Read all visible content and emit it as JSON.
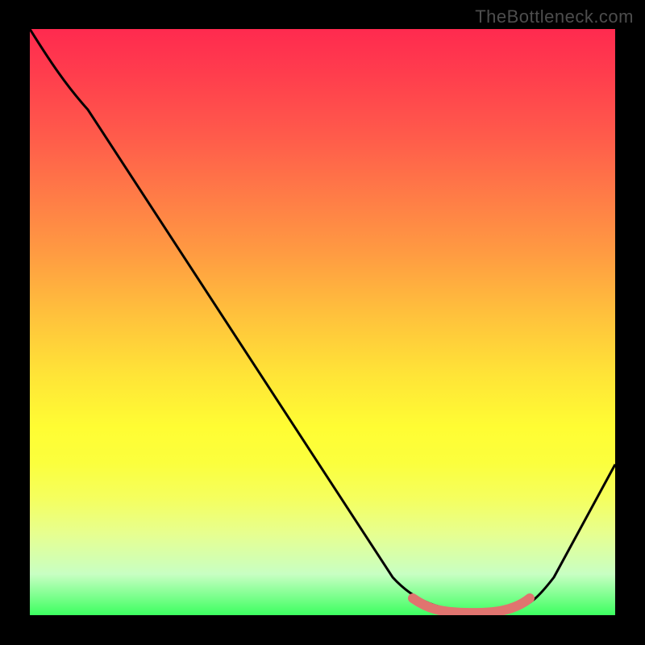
{
  "watermark": "TheBottleneck.com",
  "chart_data": {
    "type": "line",
    "title": "",
    "xlabel": "",
    "ylabel": "",
    "xlim": [
      0,
      100
    ],
    "ylim": [
      0,
      100
    ],
    "grid": false,
    "legend": false,
    "background_gradient": {
      "direction": "vertical",
      "stops": [
        {
          "pos": 0.0,
          "color": "#ff2a4f"
        },
        {
          "pos": 0.4,
          "color": "#ff9a42"
        },
        {
          "pos": 0.68,
          "color": "#fffd33"
        },
        {
          "pos": 1.0,
          "color": "#3cff60"
        }
      ]
    },
    "series": [
      {
        "name": "bottleneck-curve",
        "color": "#000000",
        "x": [
          0,
          5,
          10,
          20,
          30,
          40,
          50,
          60,
          65,
          70,
          75,
          80,
          85,
          90,
          95,
          100
        ],
        "y": [
          100,
          92,
          86,
          73,
          60,
          47,
          34,
          21,
          13,
          5,
          1,
          0,
          0.5,
          5,
          14,
          27
        ]
      },
      {
        "name": "optimal-zone-highlight",
        "color": "#e0746f",
        "line_width": 6,
        "x": [
          72,
          74,
          76,
          78,
          80,
          82,
          84,
          86,
          87
        ],
        "y": [
          2,
          1,
          0.5,
          0,
          0,
          0.3,
          0.8,
          1.5,
          2
        ]
      }
    ]
  }
}
